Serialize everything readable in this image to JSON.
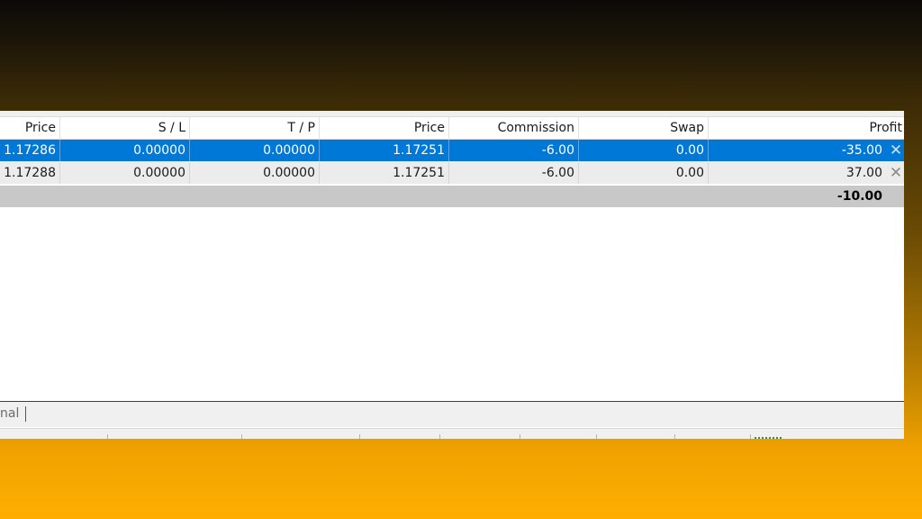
{
  "columns": [
    {
      "key": "price_open",
      "label": "Price"
    },
    {
      "key": "sl",
      "label": "S / L"
    },
    {
      "key": "tp",
      "label": "T / P"
    },
    {
      "key": "price_current",
      "label": "Price"
    },
    {
      "key": "commission",
      "label": "Commission"
    },
    {
      "key": "swap",
      "label": "Swap"
    },
    {
      "key": "profit",
      "label": "Profit"
    }
  ],
  "rows": [
    {
      "price_open": "1.17286",
      "sl": "0.00000",
      "tp": "0.00000",
      "price_current": "1.17251",
      "commission": "-6.00",
      "swap": "0.00",
      "profit": "-35.00",
      "selected": true
    },
    {
      "price_open": "1.17288",
      "sl": "0.00000",
      "tp": "0.00000",
      "price_current": "1.17251",
      "commission": "-6.00",
      "swap": "0.00",
      "profit": "37.00",
      "selected": false
    }
  ],
  "total": {
    "profit": "-10.00"
  },
  "close_glyph": "✕",
  "tabbar": {
    "partial_tab_label": "nal"
  },
  "icons": {
    "close": "close-icon"
  },
  "colors": {
    "selected_row": "#0078d7",
    "total_row": "#c8c8c8"
  }
}
